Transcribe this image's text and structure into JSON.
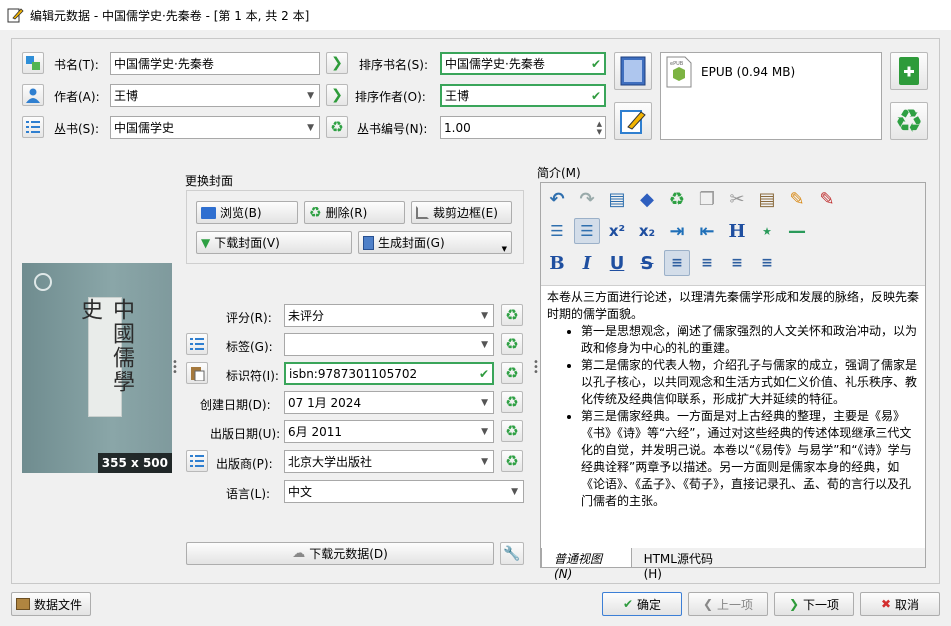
{
  "window": {
    "title": "编辑元数据 - 中国儒学史·先秦卷 - [第 1 本, 共 2 本]"
  },
  "fields": {
    "title_label": "书名(T):",
    "title_value": "中国儒学史·先秦卷",
    "title_sort_label": "排序书名(S):",
    "title_sort_value": "中国儒学史·先秦卷",
    "author_label": "作者(A):",
    "author_value": "王博",
    "author_sort_label": "排序作者(O):",
    "author_sort_value": "王博",
    "series_label": "丛书(S):",
    "series_value": "中国儒学史",
    "series_index_label": "丛书编号(N):",
    "series_index_value": "1.00"
  },
  "format": {
    "label": "EPUB (0.94 MB)"
  },
  "cover": {
    "section_label": "更换封面",
    "browse": "浏览(B)",
    "remove": "删除(R)",
    "trim": "裁剪边框(E)",
    "download": "下载封面(V)",
    "generate": "生成封面(G)",
    "size": "355 x 500",
    "book_text": "中國儒學史"
  },
  "meta": {
    "rating_label": "评分(R):",
    "rating_value": "未评分",
    "tags_label": "标签(G):",
    "tags_value": "",
    "ids_label": "标识符(I):",
    "ids_value": "isbn:9787301105702",
    "created_label": "创建日期(D):",
    "created_value": "07 1月 2024",
    "pubdate_label": "出版日期(U):",
    "pubdate_value": "6月 2011",
    "publisher_label": "出版商(P):",
    "publisher_value": "北京大学出版社",
    "language_label": "语言(L):",
    "language_value": "中文",
    "download_button": "下载元数据(D)"
  },
  "comments": {
    "label": "简介(M)",
    "intro": "本卷从三方面进行论述，以理清先秦儒学形成和发展的脉络，反映先秦时期的儒学面貌。",
    "bullets": [
      "第一是思想观念，阐述了儒家强烈的人文关怀和政治冲动，以为政和修身为中心的礼的重建。",
      "第二是儒家的代表人物，介绍孔子与儒家的成立，强调了儒家是以孔子核心，以共同观念和生活方式如仁义价值、礼乐秩序、教化传统及经典信仰联系，形成扩大并延续的特征。",
      "第三是儒家经典。一方面是对上古经典的整理，主要是《易》《书》《诗》等“六经”，通过对这些经典的传述体现继承三代文化的自觉，并发明己说。本卷以“《易传》与易学”和“《诗》学与经典诠释”两章予以描述。另一方面则是儒家本身的经典，如《论语》、《孟子》、《荀子》，直接记录孔、孟、荀的言行以及孔门儒者的主张。"
    ],
    "tab_normal": "普通视图(N)",
    "tab_html": "HTML源代码(H)"
  },
  "footer": {
    "data_files": "数据文件",
    "ok": "确定",
    "prev": "上一项",
    "next": "下一项",
    "cancel": "取消"
  }
}
